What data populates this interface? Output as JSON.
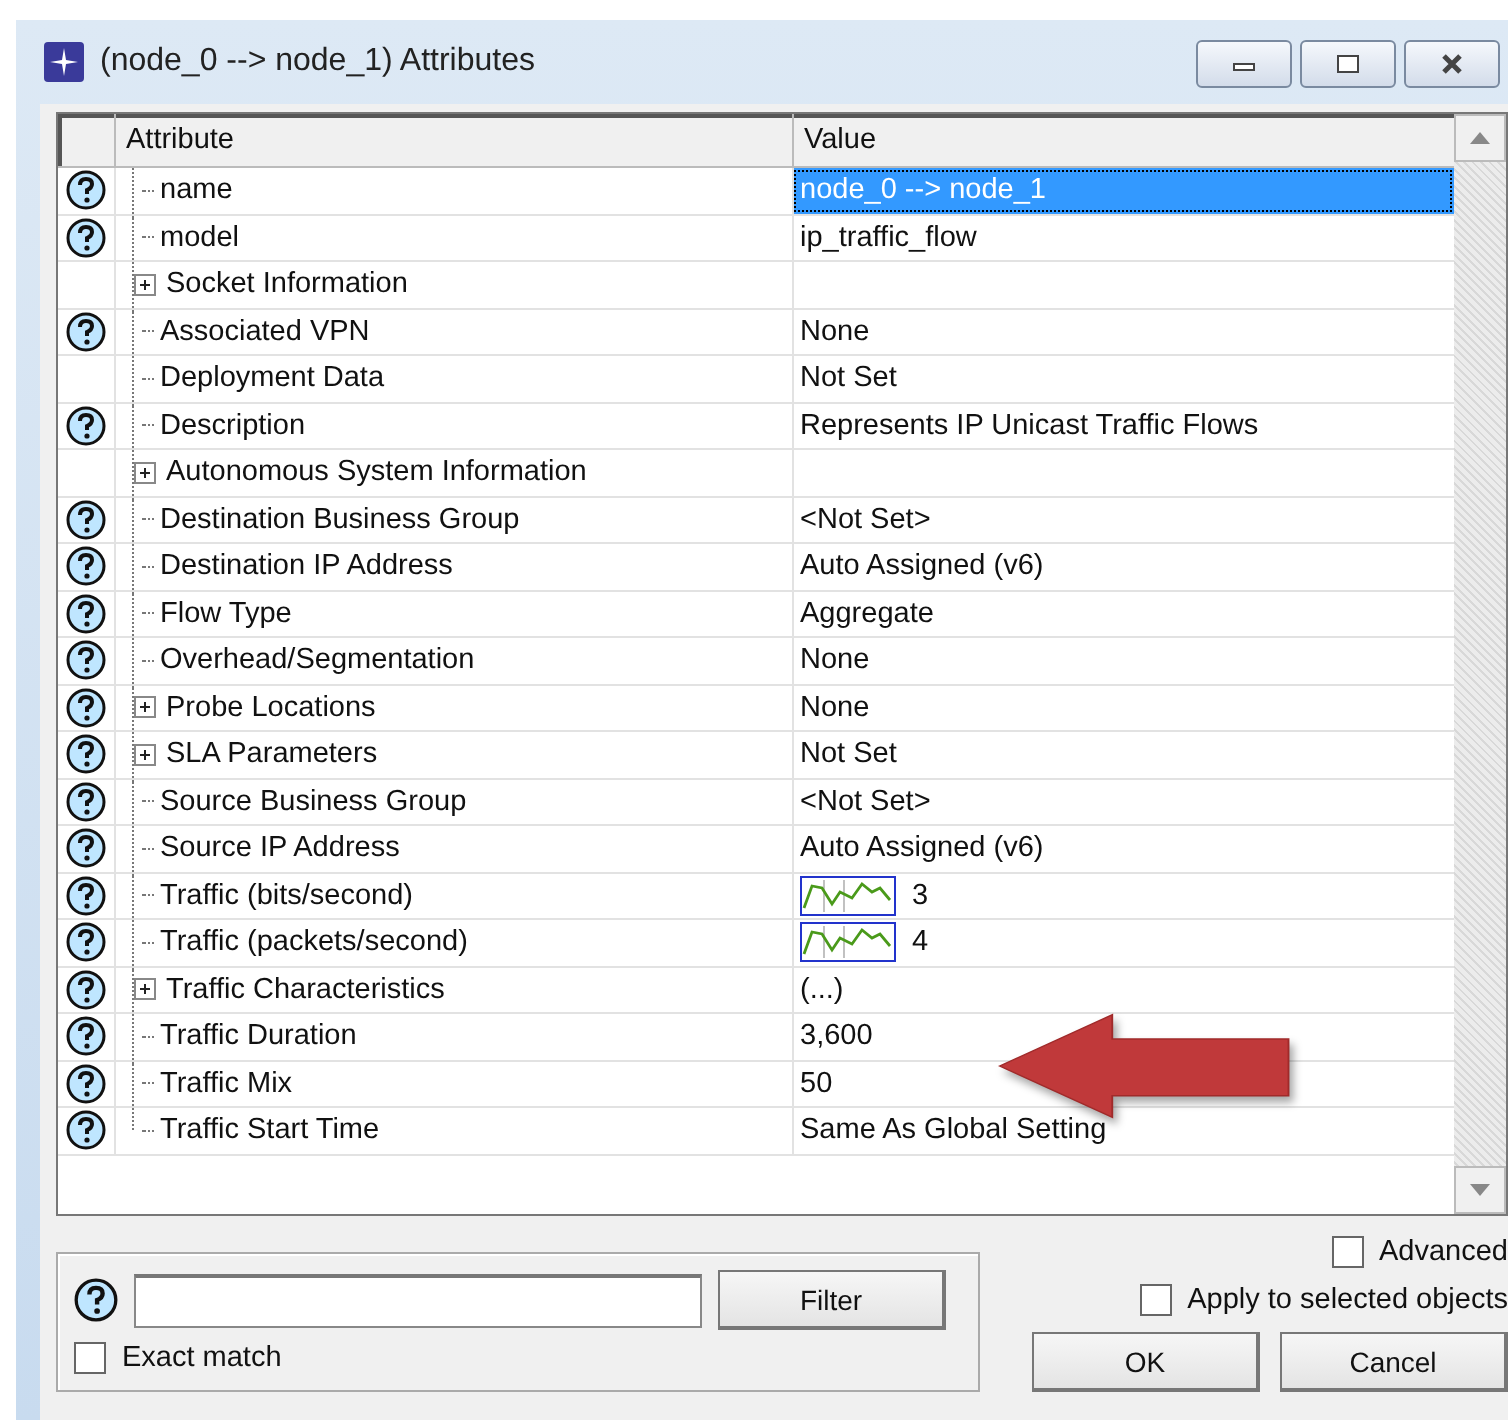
{
  "window": {
    "title": "(node_0 --> node_1) Attributes"
  },
  "table": {
    "columns": [
      "Attribute",
      "Value"
    ],
    "rows": [
      {
        "help": true,
        "expandable": false,
        "last": false,
        "attribute": "name",
        "value": "node_0 --> node_1",
        "kind": "text",
        "selected": true
      },
      {
        "help": true,
        "expandable": false,
        "last": false,
        "attribute": "model",
        "value": "ip_traffic_flow",
        "kind": "text",
        "selected": false
      },
      {
        "help": false,
        "expandable": true,
        "last": false,
        "attribute": "Socket Information",
        "selected": false
      },
      {
        "help": true,
        "expandable": false,
        "last": false,
        "attribute": "Associated VPN",
        "value": "None",
        "kind": "text",
        "selected": false
      },
      {
        "help": false,
        "expandable": false,
        "last": false,
        "attribute": "Deployment Data",
        "value": "Not Set",
        "kind": "text",
        "selected": false
      },
      {
        "help": true,
        "expandable": false,
        "last": false,
        "attribute": "Description",
        "value": "Represents IP Unicast Traffic Flows",
        "kind": "text",
        "selected": false
      },
      {
        "help": false,
        "expandable": true,
        "last": false,
        "attribute": "Autonomous System Information",
        "selected": false
      },
      {
        "help": true,
        "expandable": false,
        "last": false,
        "attribute": "Destination Business Group",
        "value": "<Not Set>",
        "kind": "text",
        "selected": false
      },
      {
        "help": true,
        "expandable": false,
        "last": false,
        "attribute": "Destination IP Address",
        "value": "Auto Assigned (v6)",
        "kind": "text",
        "selected": false
      },
      {
        "help": true,
        "expandable": false,
        "last": false,
        "attribute": "Flow Type",
        "value": "Aggregate",
        "kind": "text",
        "selected": false
      },
      {
        "help": true,
        "expandable": false,
        "last": false,
        "attribute": "Overhead/Segmentation",
        "value": "None",
        "kind": "text",
        "selected": false
      },
      {
        "help": true,
        "expandable": true,
        "last": false,
        "attribute": "Probe Locations",
        "value": "None",
        "kind": "text",
        "selected": false
      },
      {
        "help": true,
        "expandable": true,
        "last": false,
        "attribute": "SLA Parameters",
        "value": "Not Set",
        "kind": "text",
        "selected": false
      },
      {
        "help": true,
        "expandable": false,
        "last": false,
        "attribute": "Source Business Group",
        "value": "<Not Set>",
        "kind": "text",
        "selected": false
      },
      {
        "help": true,
        "expandable": false,
        "last": false,
        "attribute": "Source IP Address",
        "value": "Auto Assigned (v6)",
        "kind": "text",
        "selected": false
      },
      {
        "help": true,
        "expandable": false,
        "last": false,
        "attribute": "Traffic (bits/second)",
        "value": "3",
        "kind": "graph",
        "selected": false
      },
      {
        "help": true,
        "expandable": false,
        "last": false,
        "attribute": "Traffic (packets/second)",
        "value": "4",
        "kind": "graph",
        "selected": false
      },
      {
        "help": true,
        "expandable": true,
        "last": false,
        "attribute": "Traffic Characteristics",
        "value": "(...)",
        "kind": "text",
        "selected": false
      },
      {
        "help": true,
        "expandable": false,
        "last": false,
        "attribute": "Traffic Duration",
        "value": "3,600",
        "kind": "text",
        "selected": false
      },
      {
        "help": true,
        "expandable": false,
        "last": false,
        "attribute": "Traffic Mix",
        "value": "50",
        "kind": "text",
        "selected": false
      },
      {
        "help": true,
        "expandable": false,
        "last": true,
        "attribute": "Traffic Start Time",
        "value": "Same As Global Setting",
        "kind": "text",
        "selected": false
      }
    ]
  },
  "filter": {
    "button": "Filter",
    "exact_match": {
      "label": "Exact match",
      "checked": false
    }
  },
  "options": [
    {
      "label": "Advanced",
      "checked": false
    },
    {
      "label": "Apply to selected objects",
      "checked": false
    }
  ],
  "buttons": [
    "OK",
    "Cancel"
  ]
}
